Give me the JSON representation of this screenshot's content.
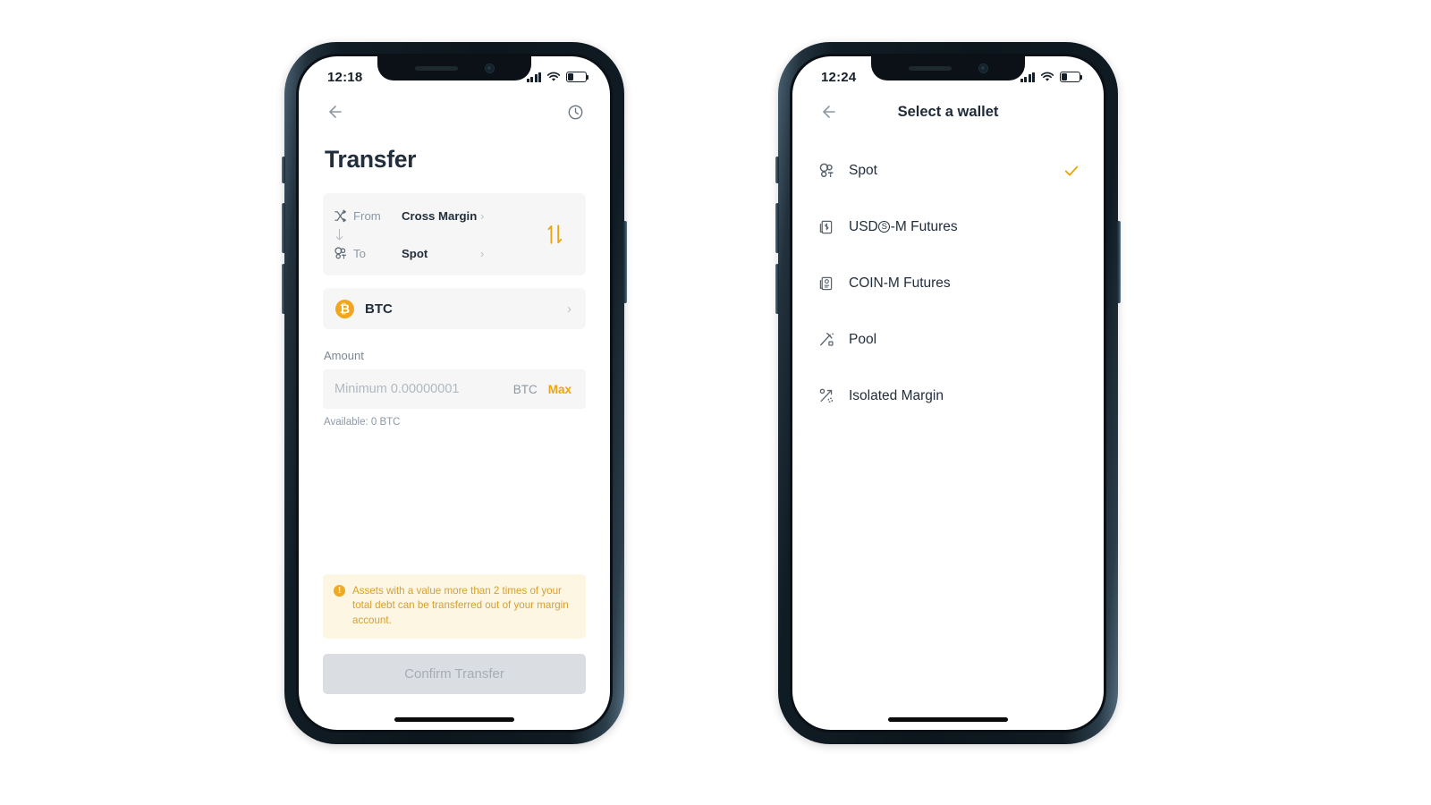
{
  "theme": {
    "accent": "#eaa512",
    "btc_orange": "#f0a71a",
    "text_dark": "#222e3c",
    "text_muted": "#8c98a4",
    "panel_bg": "#f6f6f7",
    "warn_bg": "#fdf6e3",
    "warn_text": "#d6a02f",
    "disabled_btn_bg": "#dadde1",
    "disabled_btn_text": "#a7adb5"
  },
  "phone_left": {
    "status": {
      "time": "12:18",
      "signal": "signal-bars",
      "wifi": "wifi",
      "battery": "battery-low"
    },
    "nav": {
      "back": "back-arrow",
      "history": "history-clock"
    },
    "page_title": "Transfer",
    "transfer": {
      "from_label": "From",
      "from_value": "Cross Margin",
      "to_label": "To",
      "to_value": "Spot",
      "swap_icon": "swap-vertical-arrows"
    },
    "coin": {
      "symbol": "₿",
      "name": "BTC"
    },
    "amount": {
      "label": "Amount",
      "value": "",
      "placeholder": "Minimum 0.00000001",
      "unit": "BTC",
      "max_label": "Max",
      "available": "Available: 0 BTC"
    },
    "warning": {
      "icon": "!",
      "text": "Assets with a value more than 2 times of your total debt can be transferred out of your margin account."
    },
    "confirm_label": "Confirm Transfer"
  },
  "phone_right": {
    "status": {
      "time": "12:24",
      "signal": "signal-bars",
      "wifi": "wifi",
      "battery": "battery-low"
    },
    "nav": {
      "back": "back-arrow",
      "title": "Select a wallet"
    },
    "wallets": [
      {
        "label": "Spot",
        "icon": "spot-circles-icon",
        "selected": true
      },
      {
        "label_pre": "USD",
        "label_circled": "S",
        "label_post": "-M Futures",
        "icon": "usd-futures-icon",
        "selected": false
      },
      {
        "label": "COIN-M Futures",
        "icon": "coin-futures-icon",
        "selected": false
      },
      {
        "label": "Pool",
        "icon": "pool-pickaxe-icon",
        "selected": false
      },
      {
        "label": "Isolated Margin",
        "icon": "isolated-margin-icon",
        "selected": false
      }
    ]
  }
}
